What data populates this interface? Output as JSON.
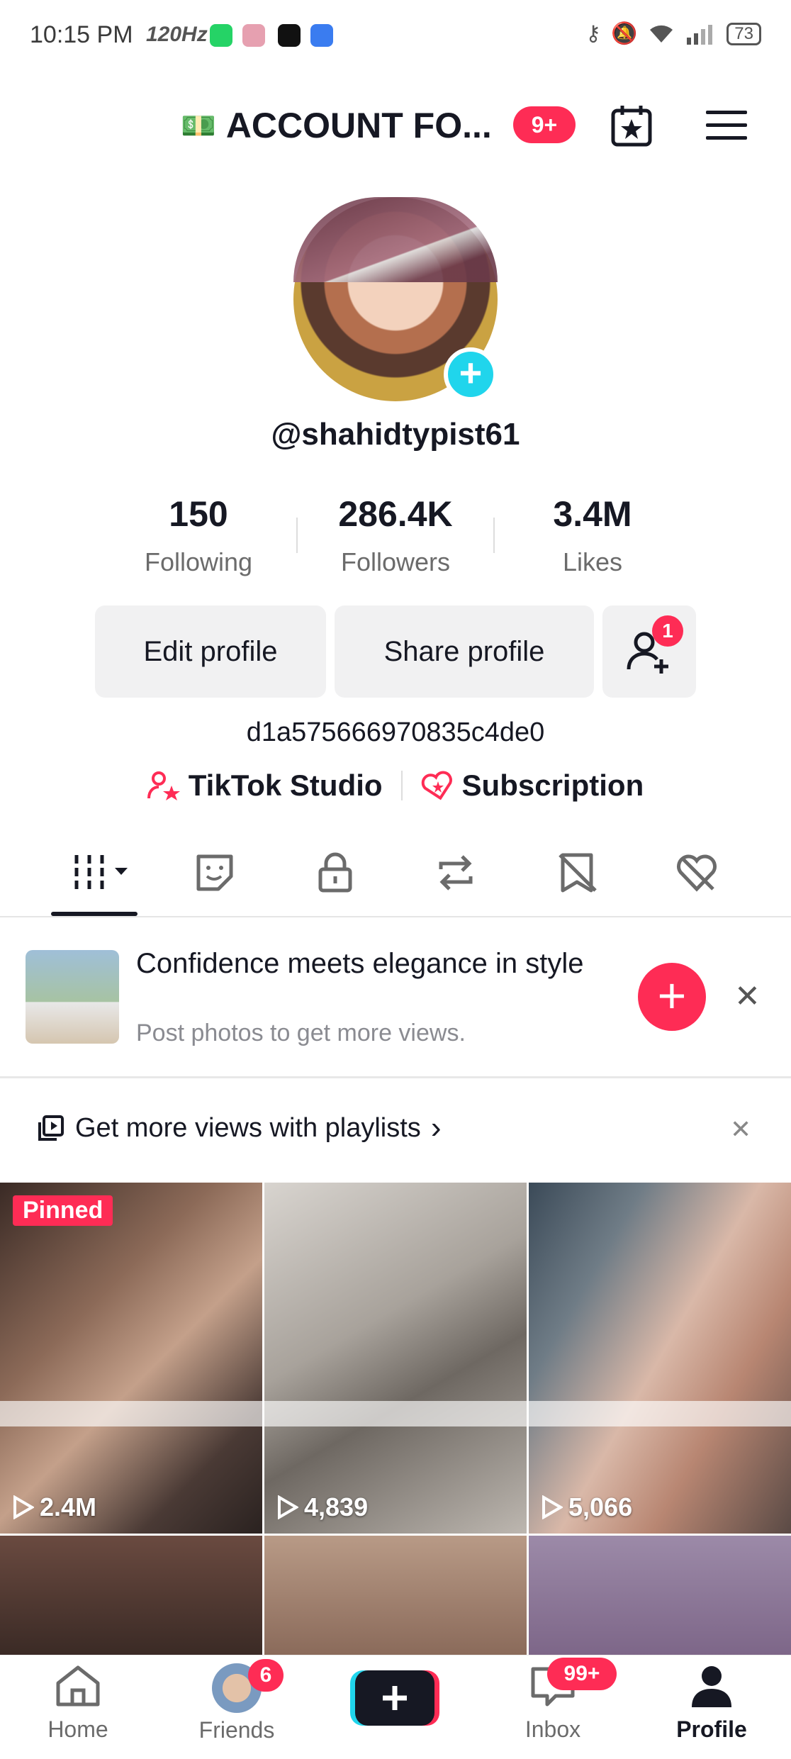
{
  "status_bar": {
    "time": "10:15 PM",
    "refresh": "120Hz",
    "battery": "73"
  },
  "header": {
    "title": "ACCOUNT FO...",
    "emoji": "💵",
    "badge": "9+"
  },
  "profile": {
    "username": "@shahidtypist61",
    "stats": [
      {
        "value": "150",
        "label": "Following"
      },
      {
        "value": "286.4K",
        "label": "Followers"
      },
      {
        "value": "3.4M",
        "label": "Likes"
      }
    ],
    "buttons": {
      "edit": "Edit profile",
      "share": "Share profile",
      "add_friends_badge": "1"
    },
    "bio": "d1a575666970835c4de0",
    "links": {
      "studio": "TikTok Studio",
      "subscription": "Subscription"
    }
  },
  "prompt": {
    "title": "Confidence meets elegance in style",
    "subtitle": "Post photos to get more views."
  },
  "playlist": {
    "label": "Get more views with playlists",
    "chevron": "›"
  },
  "grid": {
    "pinned_label": "Pinned",
    "tiles": [
      {
        "views": "2.4M"
      },
      {
        "views": "4,839"
      },
      {
        "views": "5,066"
      }
    ]
  },
  "bottom_nav": {
    "home": "Home",
    "friends": "Friends",
    "friends_badge": "6",
    "inbox": "Inbox",
    "inbox_badge": "99+",
    "profile": "Profile"
  },
  "colors": {
    "accent": "#fe2c55",
    "cyan": "#20d5ec",
    "text": "#161823",
    "muted": "#8a8b91"
  }
}
